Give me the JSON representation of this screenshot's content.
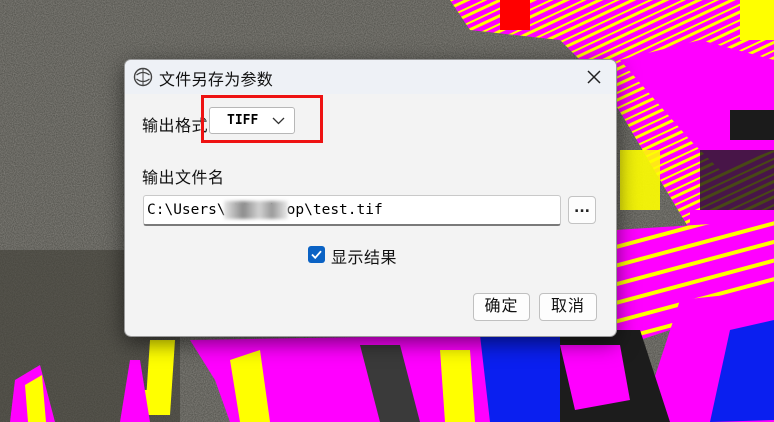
{
  "dialog": {
    "title": "文件另存为参数",
    "format_label": "输出格式",
    "format_value": "TIFF",
    "filename_label": "输出文件名",
    "path_value": "C:\\Users\\ \\Desktop\\test.tif",
    "browse_label": "...",
    "show_result_label": "显示结果",
    "show_result_checked": true,
    "ok_label": "确定",
    "cancel_label": "取消"
  },
  "colors": {
    "accent_checkbox": "#0a62c4",
    "highlight_box": "#ee1212",
    "map_magenta": "#ff00ff",
    "map_yellow": "#ffff00",
    "map_blue": "#0a1ff0",
    "map_red": "#ff0000"
  }
}
